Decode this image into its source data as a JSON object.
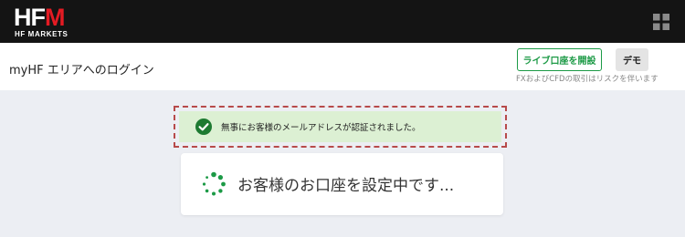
{
  "brand": {
    "logo_main_left": "HF",
    "logo_main_right": "M",
    "logo_sub": "HF MARKETS"
  },
  "header": {
    "title": "myHF エリアへのログイン",
    "live_account_button": "ライブ口座を開設",
    "demo_button": "デモ",
    "risk_note": "FXおよびCFDの取引はリスクを伴います"
  },
  "notice": {
    "message": "無事にお客様のメールアドレスが認証されました。",
    "icon": "check-circle-icon"
  },
  "loading": {
    "message": "お客様のお口座を設定中です...",
    "icon": "spinner-icon"
  },
  "colors": {
    "topbar": "#141414",
    "brand_red": "#e41b23",
    "accent_green": "#1c9a46",
    "notice_bg": "#dcf0d3",
    "notice_border": "#b74a4a",
    "page_bg": "#eceef3"
  }
}
